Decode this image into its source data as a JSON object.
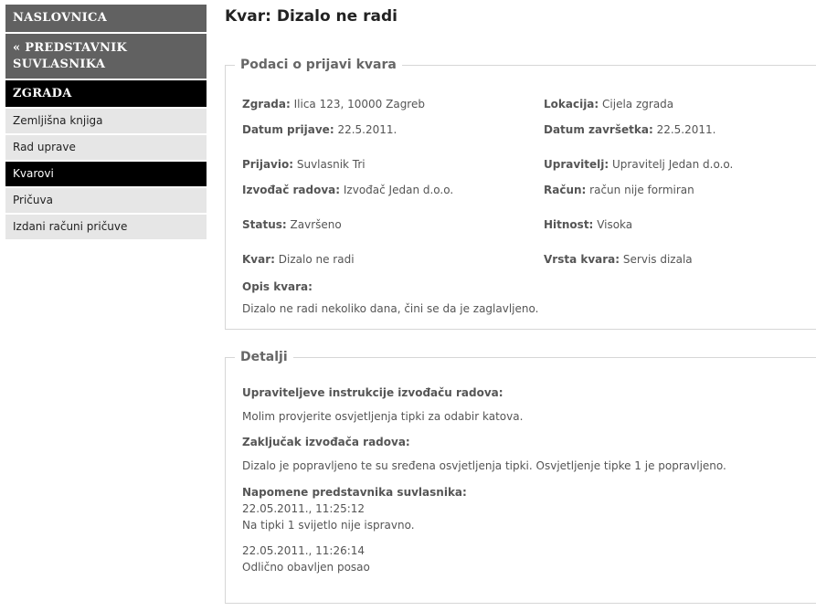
{
  "sidebar": {
    "naslovnica": "NASLOVNICA",
    "predstavnik_line1": "« PREDSTAVNIK",
    "predstavnik_line2": "SUVLASNIKA",
    "zgrada": "ZGRADA",
    "items": [
      {
        "label": "Zemljišna knjiga"
      },
      {
        "label": "Rad uprave"
      },
      {
        "label": "Kvarovi",
        "active": true
      },
      {
        "label": "Pričuva"
      },
      {
        "label": "Izdani računi pričuve"
      }
    ]
  },
  "main": {
    "title": "Kvar: Dizalo ne radi",
    "podaci": {
      "legend": "Podaci o prijavi kvara",
      "zgrada_label": "Zgrada:",
      "zgrada_value": "Ilica 123, 10000 Zagreb",
      "lokacija_label": "Lokacija:",
      "lokacija_value": "Cijela zgrada",
      "datum_prijave_label": "Datum prijave:",
      "datum_prijave_value": "22.5.2011.",
      "datum_zavrsetka_label": "Datum završetka:",
      "datum_zavrsetka_value": "22.5.2011.",
      "prijavio_label": "Prijavio:",
      "prijavio_value": "Suvlasnik Tri",
      "upravitelj_label": "Upravitelj:",
      "upravitelj_value": "Upravitelj Jedan d.o.o.",
      "izvodac_label": "Izvođač radova:",
      "izvodac_value": "Izvođač Jedan d.o.o.",
      "racun_label": "Račun:",
      "racun_value": "račun nije formiran",
      "status_label": "Status:",
      "status_value": "Završeno",
      "hitnost_label": "Hitnost:",
      "hitnost_value": "Visoka",
      "kvar_label": "Kvar:",
      "kvar_value": "Dizalo ne radi",
      "vrsta_label": "Vrsta kvara:",
      "vrsta_value": "Servis dizala",
      "opis_label": "Opis kvara:",
      "opis_value": "Dizalo ne radi nekoliko dana, čini se da je zaglavljeno."
    },
    "detalji": {
      "legend": "Detalji",
      "instrukcije_label": "Upraviteljeve instrukcije izvođaču radova:",
      "instrukcije_value": "Molim provjerite osvjetljenja tipki za odabir katova.",
      "zakljucak_label": "Zaključak izvođača radova:",
      "zakljucak_value": "Dizalo je popravljeno te su sređena osvjetljenja tipki. Osvjetljenje tipke 1 je popravljeno.",
      "napomene_label": "Napomene predstavnika suvlasnika:",
      "napomene": [
        {
          "timestamp": "22.05.2011., 11:25:12",
          "text": "Na tipki 1 svijetlo nije ispravno."
        },
        {
          "timestamp": "22.05.2011., 11:26:14",
          "text": "Odlično obavljen posao"
        }
      ]
    }
  }
}
